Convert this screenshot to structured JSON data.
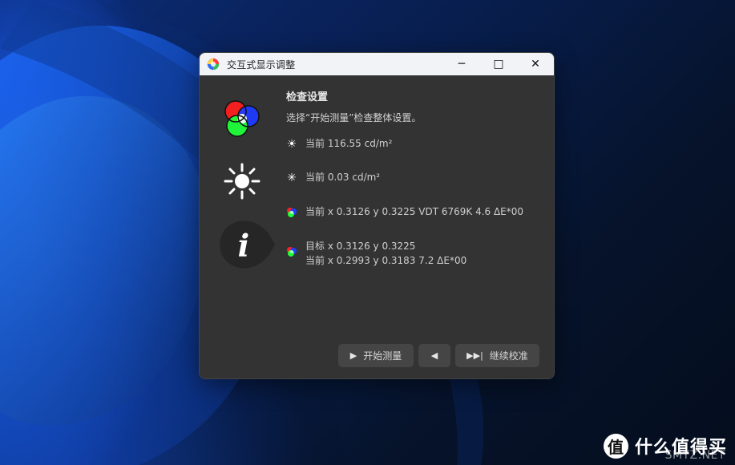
{
  "window": {
    "title": "交互式显示调整",
    "controls": {
      "minimize": "─",
      "maximize": "□",
      "close": "✕"
    }
  },
  "section": {
    "title": "检查设置",
    "subtitle": "选择“开始测量”检查整体设置。"
  },
  "rows": {
    "white_luminance": "当前 116.55 cd/m²",
    "black_luminance": "当前 0.03 cd/m²",
    "whitepoint_current": "当前 x 0.3126 y 0.3225 VDT 6769K 4.6 ΔE*00",
    "target": "目标 x 0.3126 y 0.3225",
    "target_current": "当前 x 0.2993 y 0.3183 7.2 ΔE*00"
  },
  "buttons": {
    "start_measure": "开始测量",
    "continue_calibration": "继续校准"
  },
  "watermark": {
    "logo": "值",
    "text": "什么值得买",
    "sub": "SMYZ.NET"
  },
  "colors": {
    "titlebar_bg": "#f1f3f7",
    "content_bg": "#333333",
    "button_bg": "#454545",
    "accent_red": "#ff1f1f",
    "accent_green": "#1fff3b",
    "accent_blue": "#1f3bff"
  },
  "icons": {
    "app_logo": "app-logo-icon",
    "rgb_circles": "rgb-circles-icon",
    "sun": "sun-icon",
    "info_drop": "info-drop-icon",
    "small_sun": "small-sun-icon",
    "small_dark": "small-dark-icon",
    "small_rgb": "small-rgb-icon",
    "play": "play-icon",
    "previous": "previous-icon",
    "skip_forward": "skip-forward-icon"
  }
}
